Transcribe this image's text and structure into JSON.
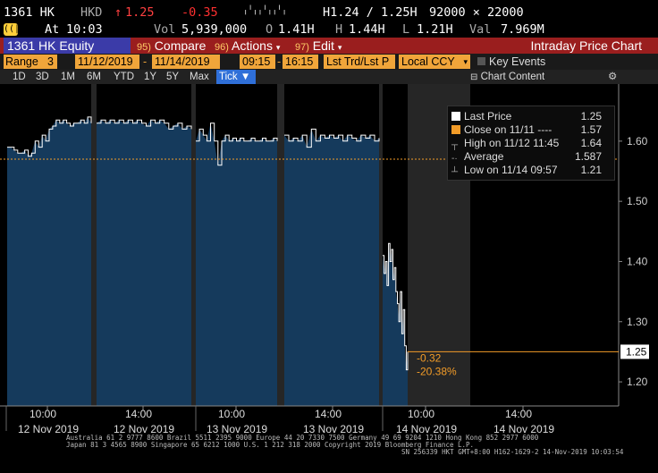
{
  "quote": {
    "ticker": "1361 HK",
    "currency": "HKD",
    "direction_arrow": "↑",
    "last": "1.25",
    "change": "-0.35",
    "spark": "╷╵╷╷╵╷╷╵╷",
    "h_label": "H",
    "h_value": "1.24 / 1.25",
    "h_suffix": "H",
    "size": "92000 × 22000",
    "at_label": "At",
    "time": "10:03",
    "vol_label": "Vol",
    "volume": "5,939,000",
    "o_label": "O",
    "open": "1.41",
    "o_suffix": "H",
    "hi_label": "H",
    "high": "1.44",
    "hi_suffix": "H",
    "lo_label": "L",
    "low": "1.21",
    "lo_suffix": "H",
    "val_label": "Val",
    "value": "7.969M"
  },
  "toolbar": {
    "security": "1361 HK Equity",
    "compare_num": "95)",
    "compare": "Compare",
    "actions_num": "96)",
    "actions": "Actions",
    "edit_num": "97)",
    "edit": "Edit",
    "title": "Intraday Price Chart"
  },
  "range": {
    "label": "Range",
    "count": "3",
    "start_date": "11/12/2019",
    "end_date": "11/14/2019",
    "start_time": "09:15",
    "end_time": "16:15",
    "market": "Lst Trd/Lst P",
    "ccy": "Local CCY",
    "key_events": "Key Events"
  },
  "periods": [
    "1D",
    "3D",
    "1M",
    "6M",
    "YTD",
    "1Y",
    "5Y",
    "Max"
  ],
  "tick_button": "Tick ▼",
  "chart_content": "Chart Content",
  "chart_data": {
    "type": "line",
    "ylim": [
      1.16,
      1.68
    ],
    "yticks": [
      1.2,
      1.3,
      1.4,
      1.5,
      1.6
    ],
    "ytick_labels": [
      "1.20",
      "1.30",
      "1.40",
      "1.50",
      "1.60"
    ],
    "close_prev": 1.57,
    "last_price_label": "1.25",
    "annotation_change": "-0.32",
    "annotation_pct": "-20.38%",
    "xtick_times": [
      "10:00",
      "14:00",
      "10:00",
      "14:00",
      "10:00",
      "14:00"
    ],
    "xtick_dates": [
      "12 Nov 2019",
      "12 Nov 2019",
      "13 Nov 2019",
      "13 Nov 2019",
      "14 Nov 2019",
      "14 Nov 2019"
    ],
    "sessions": [
      {
        "name": "12 Nov AM",
        "values": [
          1.59,
          1.59,
          1.585,
          1.58,
          1.58,
          1.585,
          1.575,
          1.58,
          1.6,
          1.59,
          1.61,
          1.6,
          1.62,
          1.625,
          1.635,
          1.63,
          1.635,
          1.63,
          1.625,
          1.63,
          1.63,
          1.635,
          1.63,
          1.64,
          1.63
        ]
      },
      {
        "name": "12 Nov PM",
        "values": [
          1.63,
          1.635,
          1.63,
          1.635,
          1.63,
          1.635,
          1.63,
          1.635,
          1.63,
          1.635,
          1.63,
          1.625,
          1.635,
          1.63,
          1.635,
          1.63,
          1.62,
          1.625,
          1.63,
          1.62,
          1.625,
          1.62
        ]
      },
      {
        "name": "13 Nov AM",
        "values": [
          1.6,
          1.62,
          1.61,
          1.6,
          1.63,
          1.6,
          1.56,
          1.6,
          1.61,
          1.6,
          1.605,
          1.6,
          1.605,
          1.6,
          1.6,
          1.605,
          1.6,
          1.6,
          1.605,
          1.6,
          1.6,
          1.605,
          1.6
        ]
      },
      {
        "name": "13 Nov PM",
        "values": [
          1.61,
          1.6,
          1.605,
          1.6,
          1.61,
          1.59,
          1.62,
          1.6,
          1.61,
          1.605,
          1.61,
          1.605,
          1.61,
          1.6,
          1.61,
          1.605,
          1.6,
          1.61,
          1.605,
          1.61,
          1.6,
          1.605
        ]
      },
      {
        "name": "14 Nov AM",
        "values": [
          1.41,
          1.38,
          1.4,
          1.36,
          1.43,
          1.4,
          1.42,
          1.37,
          1.39,
          1.35,
          1.33,
          1.3,
          1.35,
          1.28,
          1.32,
          1.26,
          1.22,
          1.25
        ]
      }
    ]
  },
  "legend": {
    "items": [
      {
        "label": "Last Price",
        "value": "1.25",
        "color": "#ffffff"
      },
      {
        "label": "Close on 11/11 ---- ",
        "value": "1.57",
        "color": "#f39c28"
      },
      {
        "label": "High on 11/12 11:45",
        "value": "1.64",
        "color": "#aaaaaa"
      },
      {
        "label": "Average",
        "value": "1.587",
        "color": "#aaaaaa"
      },
      {
        "label": "Low on 11/14 09:57",
        "value": "1.21",
        "color": "#aaaaaa"
      }
    ]
  },
  "footer": {
    "line1": "Australia 61 2 9777 8600 Brazil 5511 2395 9000 Europe 44 20 7330 7500 Germany 49 69 9204 1210 Hong Kong 852 2977 6000",
    "line2": "Japan 81 3 4565 8900         Singapore 65 6212 1000          U.S. 1 212 318 2000         Copyright 2019 Bloomberg Finance L.P.",
    "line3": "SN 256339 HKT  GMT+8:00 H162-1629-2 14-Nov-2019 10:03:54"
  },
  "colors": {
    "toolbar": "#9a1e1e",
    "security_box": "#3b3ba8",
    "range_fields": "#f0a53a",
    "area_fill": "#153a5c",
    "close_line": "#f39c28",
    "tick_button": "#2f6fd8"
  }
}
